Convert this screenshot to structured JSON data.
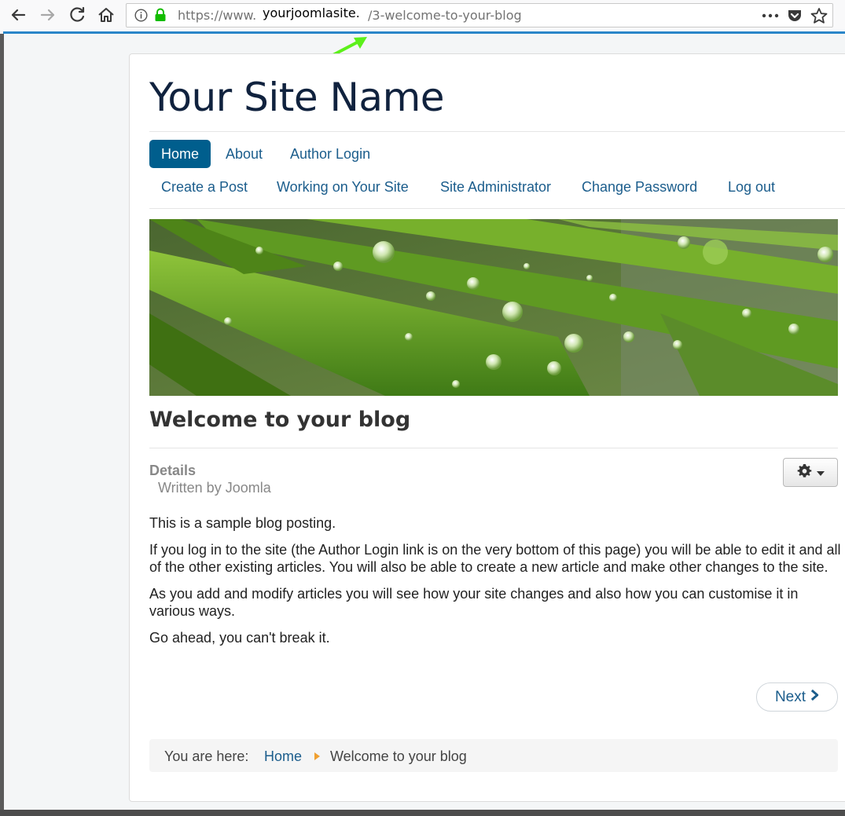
{
  "browser": {
    "url_prefix": "https://www.",
    "url_suffix": "/3-welcome-to-your-blog",
    "url_overlay": "yourjoomlasite."
  },
  "site": {
    "title": "Your Site Name"
  },
  "menu": {
    "items": [
      {
        "label": "Home"
      },
      {
        "label": "About"
      },
      {
        "label": "Author Login"
      },
      {
        "label": "Create a Post"
      },
      {
        "label": "Working on Your Site"
      },
      {
        "label": "Site Administrator"
      },
      {
        "label": "Change Password"
      },
      {
        "label": "Log out"
      }
    ]
  },
  "article": {
    "title": "Welcome to your blog",
    "details_label": "Details",
    "author": "Written by Joomla",
    "paragraphs": [
      "This is a sample blog posting.",
      "If you log in to the site (the Author Login link is on the very bottom of this page) you will be able to edit it and all of the other existing articles. You will also be able to create a new article and make other changes to the site.",
      "As you add and modify articles you will see how your site changes and also how you can customise it in various ways.",
      "Go ahead, you can't break it."
    ],
    "next_label": "Next"
  },
  "breadcrumb": {
    "label": "You are here:",
    "home": "Home",
    "current": "Welcome to your blog"
  },
  "colors": {
    "accent": "#005e8d",
    "link": "#1b5d8c",
    "annotation_arrow": "#5cf01a"
  }
}
